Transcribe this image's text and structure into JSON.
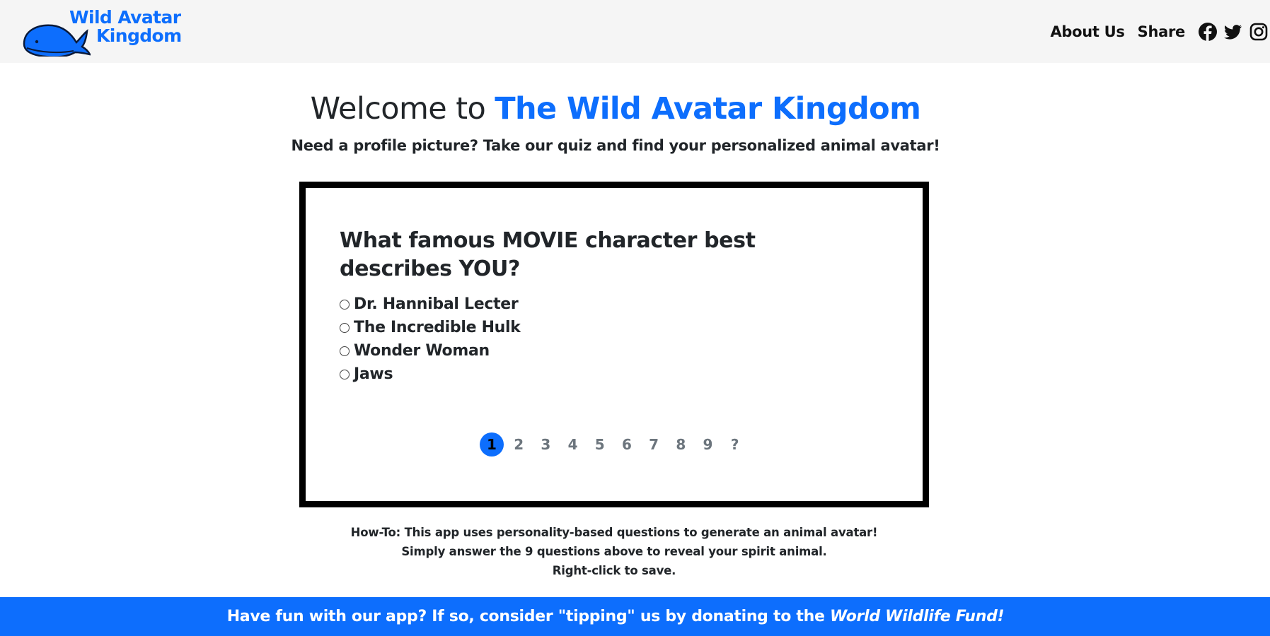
{
  "header": {
    "logo": {
      "line1": "Wild Avatar",
      "line2": "Kingdom"
    },
    "nav": {
      "about_label": "About Us",
      "share_label": "Share"
    },
    "social_icons": [
      "facebook-icon",
      "twitter-icon",
      "instagram-icon"
    ]
  },
  "hero": {
    "welcome_prefix": "Welcome to ",
    "welcome_brand": "The Wild Avatar Kingdom",
    "tagline": "Need a profile picture? Take our quiz and find your personalized animal avatar!"
  },
  "quiz": {
    "question": "What famous MOVIE character best describes YOU?",
    "options": [
      {
        "label": "Dr. Hannibal Lecter",
        "selected": false
      },
      {
        "label": "The Incredible Hulk",
        "selected": false
      },
      {
        "label": "Wonder Woman",
        "selected": false
      },
      {
        "label": "Jaws",
        "selected": false
      }
    ],
    "pages": [
      "1",
      "2",
      "3",
      "4",
      "5",
      "6",
      "7",
      "8",
      "9",
      "?"
    ],
    "active_page": "1"
  },
  "howto": {
    "line1": "How-To: This app uses personality-based questions to generate an animal avatar!",
    "line2": "Simply answer the 9 questions above to reveal your spirit animal.",
    "line3": "Right-click to save."
  },
  "banner": {
    "text": "Have fun with our app? If so, consider \"tipping\" us by donating to the ",
    "link": "World Wildlife Fund!"
  },
  "colors": {
    "accent": "#0d6efd",
    "header_bg": "#f5f5f5",
    "text": "#212529",
    "inactive_page": "#6c757d"
  }
}
